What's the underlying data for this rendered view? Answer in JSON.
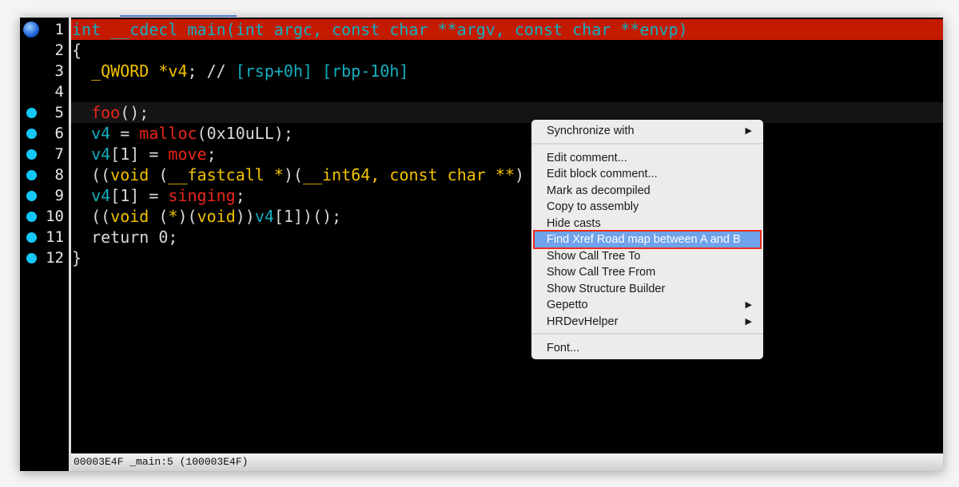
{
  "lines": [
    {
      "n": "1",
      "tokens": [
        {
          "t": "int __cdecl main(int argc, const char **argv, const char **envp)",
          "c": "cyan"
        }
      ]
    },
    {
      "n": "2",
      "tokens": [
        {
          "t": "{",
          "c": "wht"
        }
      ]
    },
    {
      "n": "3",
      "tokens": [
        {
          "t": "  _QWORD *v4",
          "c": "yel"
        },
        {
          "t": "; // ",
          "c": "wht"
        },
        {
          "t": "[rsp+0h] [rbp-10h]",
          "c": "cyan"
        }
      ]
    },
    {
      "n": "4",
      "tokens": []
    },
    {
      "n": "5",
      "tokens": [
        {
          "t": "  foo",
          "c": "red"
        },
        {
          "t": "();",
          "c": "wht"
        }
      ]
    },
    {
      "n": "6",
      "tokens": [
        {
          "t": "  v4",
          "c": "cyan"
        },
        {
          "t": " = ",
          "c": "wht"
        },
        {
          "t": "malloc",
          "c": "red"
        },
        {
          "t": "(0x10uLL);",
          "c": "wht"
        }
      ]
    },
    {
      "n": "7",
      "tokens": [
        {
          "t": "  v4",
          "c": "cyan"
        },
        {
          "t": "[1] = ",
          "c": "wht"
        },
        {
          "t": "move",
          "c": "red"
        },
        {
          "t": ";",
          "c": "wht"
        }
      ]
    },
    {
      "n": "8",
      "tokens": [
        {
          "t": "  ((",
          "c": "wht"
        },
        {
          "t": "void",
          "c": "yel"
        },
        {
          "t": " (",
          "c": "wht"
        },
        {
          "t": "__fastcall *",
          "c": "yel"
        },
        {
          "t": ")(",
          "c": "wht"
        },
        {
          "t": "__int64, const char **",
          "c": "yel"
        },
        {
          "t": ")",
          "c": "wht"
        }
      ]
    },
    {
      "n": "9",
      "tokens": [
        {
          "t": "  v4",
          "c": "cyan"
        },
        {
          "t": "[1] = ",
          "c": "wht"
        },
        {
          "t": "singing",
          "c": "red"
        },
        {
          "t": ";",
          "c": "wht"
        }
      ]
    },
    {
      "n": "10",
      "tokens": [
        {
          "t": "  ((",
          "c": "wht"
        },
        {
          "t": "void",
          "c": "yel"
        },
        {
          "t": " (",
          "c": "wht"
        },
        {
          "t": "*",
          "c": "yel"
        },
        {
          "t": ")(",
          "c": "wht"
        },
        {
          "t": "void",
          "c": "yel"
        },
        {
          "t": "))",
          "c": "wht"
        },
        {
          "t": "v4",
          "c": "cyan"
        },
        {
          "t": "[1])();",
          "c": "wht"
        }
      ]
    },
    {
      "n": "11",
      "tokens": [
        {
          "t": "  return 0;",
          "c": "wht"
        }
      ]
    },
    {
      "n": "12",
      "tokens": [
        {
          "t": "}",
          "c": "wht"
        }
      ]
    }
  ],
  "breakpoints": [
    "1",
    "5",
    "6",
    "7",
    "8",
    "9",
    "10",
    "11",
    "12"
  ],
  "highlight_line": "1",
  "current_line": "5",
  "status": "00003E4F _main:5 (100003E4F)",
  "menu": {
    "items": [
      {
        "label": "Synchronize with",
        "submenu": true
      },
      {
        "sep": true
      },
      {
        "label": "Edit comment..."
      },
      {
        "label": "Edit block comment..."
      },
      {
        "label": "Mark as decompiled"
      },
      {
        "label": "Copy to assembly"
      },
      {
        "label": "Hide casts"
      },
      {
        "label": "Find Xref Road map between A and B",
        "selected": true
      },
      {
        "label": "Show Call Tree To"
      },
      {
        "label": "Show Call Tree From"
      },
      {
        "label": "Show Structure Builder"
      },
      {
        "label": "Gepetto",
        "submenu": true
      },
      {
        "label": "HRDevHelper",
        "submenu": true
      },
      {
        "sep": true
      },
      {
        "label": "Font..."
      }
    ]
  },
  "colors": {
    "highlight": "#c41a00",
    "breakpoint": "#14c8f8",
    "menu_selected": "#6fa2ea"
  }
}
